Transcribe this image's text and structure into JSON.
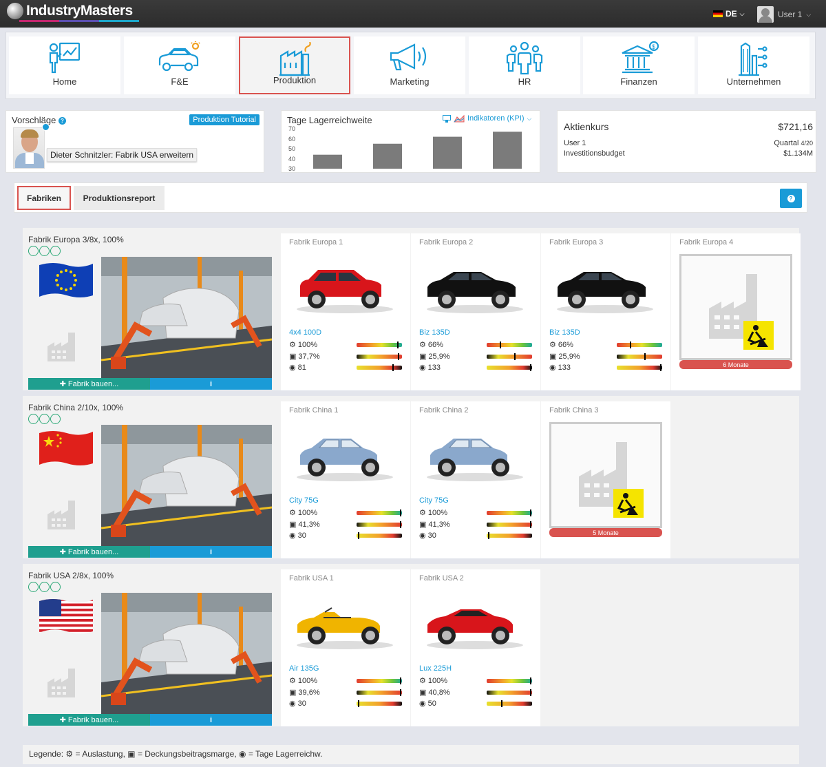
{
  "app": {
    "name": "IndustryMasters",
    "lang": "DE",
    "user": "User 1"
  },
  "colors": {
    "accent": "#1a9bd7",
    "teal": "#1f9f8f",
    "active_border": "#d9534f",
    "logo_lines": [
      "#c2266e",
      "#5b4fb0",
      "#1ca6c9"
    ]
  },
  "nav": [
    {
      "label": "Home",
      "icon": "presentation-chart-icon"
    },
    {
      "label": "F&E",
      "icon": "car-idea-icon"
    },
    {
      "label": "Produktion",
      "icon": "factory-icon",
      "active": true
    },
    {
      "label": "Marketing",
      "icon": "megaphone-icon"
    },
    {
      "label": "HR",
      "icon": "people-icon"
    },
    {
      "label": "Finanzen",
      "icon": "bank-icon"
    },
    {
      "label": "Unternehmen",
      "icon": "office-building-icon"
    }
  ],
  "vorschlaege": {
    "title": "Vorschläge",
    "tutorial": "Produktion Tutorial",
    "tip": "Dieter Schnitzler: Fabrik USA erweitern"
  },
  "lager": {
    "title": "Tage Lagerreichweite",
    "kpi": "Indikatoren (KPI)"
  },
  "chart_data": {
    "type": "bar",
    "title": "Tage Lagerreichweite",
    "yticks": [
      70,
      60,
      50,
      40,
      30
    ],
    "ylim": [
      30,
      70
    ],
    "values": [
      44,
      55,
      62,
      67
    ]
  },
  "aktien": {
    "title": "Aktienkurs",
    "price": "$721,16",
    "user": "User 1",
    "quarter_label": "Quartal",
    "quarter_value": "4/20",
    "budget_label": "Investitionsbudget",
    "budget": "$1.134M"
  },
  "tabs": {
    "fabriken": "Fabriken",
    "report": "Produktionsreport"
  },
  "build_label": "Fabrik bauen...",
  "info_label": "i",
  "regions": [
    {
      "title": "Fabrik Europa 3/8x, 100%",
      "flag": "eu",
      "factories": [
        {
          "name": "Fabrik Europa 1",
          "car": "4x4 100D",
          "car_color": "#d8151b",
          "type": "suv",
          "util": "100%",
          "margin": "37,7%",
          "days": "81",
          "m1": 0.92,
          "m2": 0.93,
          "m3": 0.82
        },
        {
          "name": "Fabrik Europa 2",
          "car": "Biz 135D",
          "car_color": "#111",
          "type": "sedan",
          "util": "66%",
          "margin": "25,9%",
          "days": "133",
          "m1": 0.3,
          "m2": 0.63,
          "m3": 0.99
        },
        {
          "name": "Fabrik Europa 3",
          "car": "Biz 135D",
          "car_color": "#111",
          "type": "sedan",
          "util": "66%",
          "margin": "25,9%",
          "days": "133",
          "m1": 0.3,
          "m2": 0.63,
          "m3": 0.99
        },
        {
          "name": "Fabrik Europa 4",
          "empty": true,
          "months": "6 Monate"
        }
      ]
    },
    {
      "title": "Fabrik China 2/10x, 100%",
      "flag": "cn",
      "factories": [
        {
          "name": "Fabrik China 1",
          "car": "City 75G",
          "car_color": "#8aa8cc",
          "type": "hatch",
          "util": "100%",
          "margin": "41,3%",
          "days": "30",
          "m1": 0.99,
          "m2": 0.99,
          "m3": 0.03
        },
        {
          "name": "Fabrik China 2",
          "car": "City 75G",
          "car_color": "#8aa8cc",
          "type": "hatch",
          "util": "100%",
          "margin": "41,3%",
          "days": "30",
          "m1": 0.99,
          "m2": 0.99,
          "m3": 0.03
        },
        {
          "name": "Fabrik China 3",
          "empty": true,
          "months": "5 Monate"
        }
      ]
    },
    {
      "title": "Fabrik USA 2/8x, 100%",
      "flag": "us",
      "factories": [
        {
          "name": "Fabrik USA 1",
          "car": "Air 135G",
          "car_color": "#f0b400",
          "type": "cabrio",
          "util": "100%",
          "margin": "39,6%",
          "days": "30",
          "m1": 0.99,
          "m2": 0.99,
          "m3": 0.03
        },
        {
          "name": "Fabrik USA 2",
          "car": "Lux 225H",
          "car_color": "#d8151b",
          "type": "coupe",
          "util": "100%",
          "margin": "40,8%",
          "days": "50",
          "m1": 0.99,
          "m2": 0.99,
          "m3": 0.33
        }
      ]
    }
  ],
  "legend": {
    "prefix": "Legende:",
    "util": "= Auslastung,",
    "margin": "= Deckungsbeitragsmarge,",
    "days": "= Tage Lagerreichw."
  }
}
